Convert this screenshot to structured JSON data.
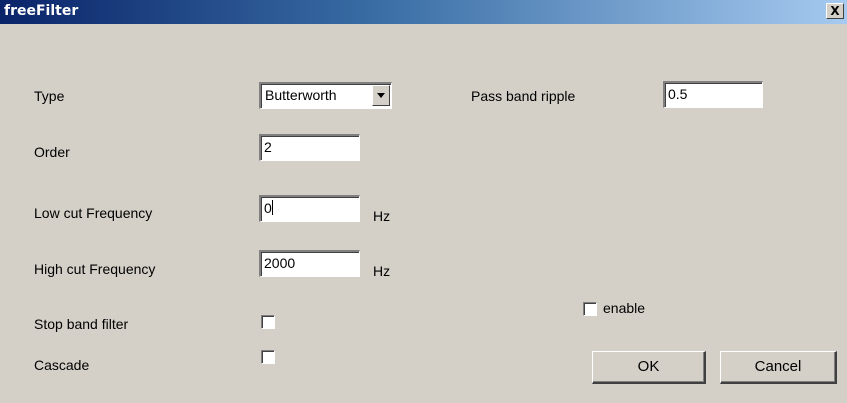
{
  "window": {
    "title": "freeFilter",
    "close_glyph": "X"
  },
  "form": {
    "type": {
      "label": "Type",
      "value": "Butterworth",
      "icon": "chevron-down-icon"
    },
    "order": {
      "label": "Order",
      "value": "2"
    },
    "low_cut": {
      "label": "Low cut Frequency",
      "value": "0",
      "unit": "Hz"
    },
    "high_cut": {
      "label": "High cut Frequency",
      "value": "2000",
      "unit": "Hz"
    },
    "stop_band": {
      "label": "Stop band filter",
      "checked": false
    },
    "cascade": {
      "label": "Cascade",
      "checked": false
    },
    "pass_band_ripple": {
      "label": "Pass band ripple",
      "value": "0.5"
    },
    "enable": {
      "label": "enable",
      "checked": false
    }
  },
  "buttons": {
    "ok": "OK",
    "cancel": "Cancel"
  },
  "colors": {
    "dialog_bg": "#d4d0c8",
    "titlebar_start": "#0a246a",
    "titlebar_end": "#a6caf0",
    "title_text": "#ffffff"
  }
}
